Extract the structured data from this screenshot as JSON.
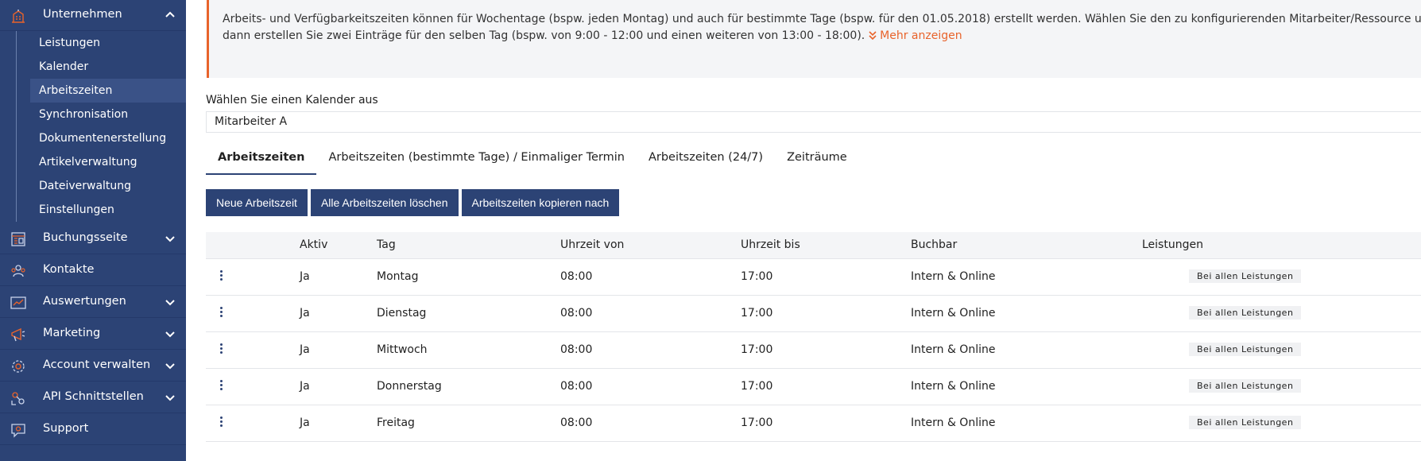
{
  "sidebar": {
    "sections": [
      {
        "label": "Unternehmen",
        "icon": "building-icon",
        "expanded": true
      },
      {
        "label": "Buchungsseite",
        "icon": "booking-page-icon",
        "expanded": false
      },
      {
        "label": "Kontakte",
        "icon": "contacts-icon",
        "expanded": false
      },
      {
        "label": "Auswertungen",
        "icon": "reports-icon",
        "expanded": false
      },
      {
        "label": "Marketing",
        "icon": "megaphone-icon",
        "expanded": false
      },
      {
        "label": "Account verwalten",
        "icon": "gear-icon",
        "expanded": false
      },
      {
        "label": "API Schnittstellen",
        "icon": "api-icon",
        "expanded": false
      },
      {
        "label": "Support",
        "icon": "support-icon",
        "expanded": false
      }
    ],
    "sub_items": [
      {
        "label": "Leistungen"
      },
      {
        "label": "Kalender"
      },
      {
        "label": "Arbeitszeiten",
        "active": true
      },
      {
        "label": "Synchronisation"
      },
      {
        "label": "Dokumentenerstellung"
      },
      {
        "label": "Artikelverwaltung"
      },
      {
        "label": "Dateiverwaltung"
      },
      {
        "label": "Einstellungen"
      }
    ]
  },
  "info": {
    "line1": "Arbeits- und Verfügbarkeitszeiten können für Wochentage (bspw. jeden Montag) und auch für bestimmte Tage (bspw. für den 01.05.2018) erstellt werden. Wählen Sie den zu konfigurierenden Mitarbeiter/Ressource und klicken Sie au",
    "line2": "dann erstellen Sie zwei Einträge für den selben Tag (bspw. von 9:00 - 12:00 und einen weiteren von 13:00 - 18:00).",
    "more_label": "Mehr anzeigen"
  },
  "calendar": {
    "label": "Wählen Sie einen Kalender aus",
    "selected": "Mitarbeiter A"
  },
  "tabs": [
    {
      "label": "Arbeitszeiten",
      "active": true
    },
    {
      "label": "Arbeitszeiten (bestimmte Tage) / Einmaliger Termin"
    },
    {
      "label": "Arbeitszeiten (24/7)"
    },
    {
      "label": "Zeiträume"
    }
  ],
  "buttons": {
    "new": "Neue Arbeitszeit",
    "delete_all": "Alle Arbeitszeiten löschen",
    "copy": "Arbeitszeiten kopieren nach"
  },
  "table": {
    "headers": {
      "aktiv": "Aktiv",
      "tag": "Tag",
      "von": "Uhrzeit von",
      "bis": "Uhrzeit bis",
      "buchbar": "Buchbar",
      "leistungen": "Leistungen"
    },
    "rows": [
      {
        "aktiv": "Ja",
        "tag": "Montag",
        "von": "08:00",
        "bis": "17:00",
        "buchbar": "Intern & Online",
        "leistungen": "Bei allen Leistungen"
      },
      {
        "aktiv": "Ja",
        "tag": "Dienstag",
        "von": "08:00",
        "bis": "17:00",
        "buchbar": "Intern & Online",
        "leistungen": "Bei allen Leistungen"
      },
      {
        "aktiv": "Ja",
        "tag": "Mittwoch",
        "von": "08:00",
        "bis": "17:00",
        "buchbar": "Intern & Online",
        "leistungen": "Bei allen Leistungen"
      },
      {
        "aktiv": "Ja",
        "tag": "Donnerstag",
        "von": "08:00",
        "bis": "17:00",
        "buchbar": "Intern & Online",
        "leistungen": "Bei allen Leistungen"
      },
      {
        "aktiv": "Ja",
        "tag": "Freitag",
        "von": "08:00",
        "bis": "17:00",
        "buchbar": "Intern & Online",
        "leistungen": "Bei allen Leistungen"
      }
    ]
  },
  "colors": {
    "sidebar_bg": "#2c4375",
    "accent": "#e8632b",
    "button_bg": "#2c4375"
  }
}
